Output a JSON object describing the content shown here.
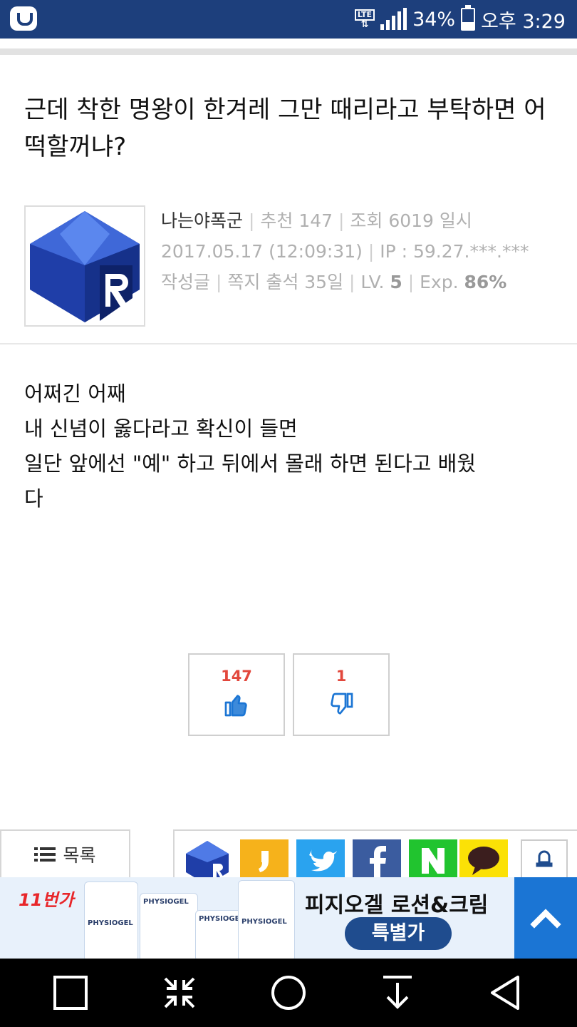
{
  "status_bar": {
    "network": "LTE",
    "battery_percent": "34%",
    "time": "오후 3:29"
  },
  "post": {
    "title": "근데 착한 명왕이 한겨레 그만 때리라고 부탁하면 어떡할꺼냐?",
    "author": {
      "nickname": "나는야폭군",
      "recommend_label": "추천",
      "recommend_count": "147",
      "views_label": "조회",
      "views_count": "6019",
      "date_label": "일시",
      "datetime": "2017.05.17 (12:09:31)",
      "ip_label": "IP :",
      "ip": "59.27.***.***",
      "posts_link": "작성글",
      "message_link": "쪽지",
      "attendance": "출석 35일",
      "level_label": "LV.",
      "level": "5",
      "exp_label": "Exp.",
      "exp": "86%"
    },
    "body_lines": [
      "어쩌긴 어째",
      "내 신념이 옳다라고 확신이 들면",
      "일단  앞에선 \"예\" 하고 뒤에서 몰래 하면 된다고 배웠",
      "다"
    ]
  },
  "votes": {
    "up_count": "147",
    "down_count": "1",
    "up_icon": "thumbs-up-icon",
    "down_icon": "thumbs-down-icon"
  },
  "actions": {
    "list_label": "목록",
    "share_icons": [
      "site-logo-icon",
      "kakaostory-icon",
      "twitter-icon",
      "facebook-icon",
      "naver-icon",
      "kakaotalk-icon",
      "notification-bell-icon"
    ]
  },
  "ad": {
    "brand": "11번가",
    "headline": "피지오겔 로션&크림",
    "badge": "특별가",
    "product": "PHYSIOGEL"
  },
  "colors": {
    "status_bar": "#1d3f7c",
    "vote_count": "#e2473c",
    "vote_icon": "#1b75d4",
    "up_button": "#1b75d4",
    "ad_bg": "#e8f1fb",
    "ad_pill": "#1f4c8e"
  }
}
